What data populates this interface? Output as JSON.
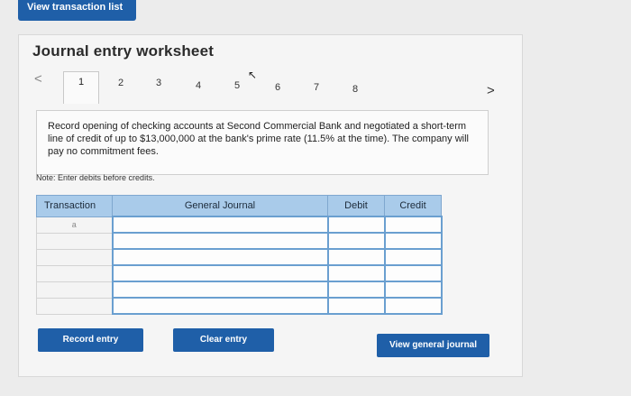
{
  "toolbar": {
    "view_transaction_label": "View transaction list"
  },
  "worksheet": {
    "title": "Journal entry worksheet",
    "tabs": [
      "1",
      "2",
      "3",
      "4",
      "5",
      "6",
      "7",
      "8"
    ],
    "active_tab": "1",
    "prev_symbol": "<",
    "next_symbol": ">",
    "instruction": "Record opening of checking accounts at Second Commercial Bank and negotiated a short-term line of credit of up to $13,000,000 at the bank's prime rate (11.5% at the time). The company will pay no commitment fees.",
    "note": "Note: Enter debits before credits."
  },
  "table": {
    "headers": [
      "Transaction",
      "General Journal",
      "Debit",
      "Credit"
    ],
    "first_transaction": "a"
  },
  "buttons": {
    "record_entry": "Record entry",
    "clear_entry": "Clear entry",
    "view_general_journal": "View general journal"
  },
  "colors": {
    "button": "#1f5fa8",
    "header": "#a9cbea"
  }
}
